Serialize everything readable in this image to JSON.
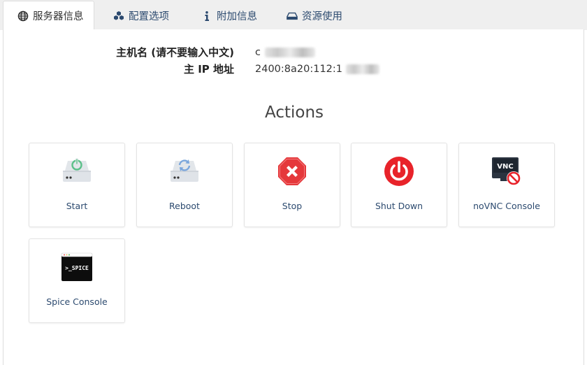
{
  "tabs": [
    {
      "label": "服务器信息",
      "icon": "globe-icon",
      "active": true
    },
    {
      "label": "配置选项",
      "icon": "cubes-icon",
      "active": false
    },
    {
      "label": "附加信息",
      "icon": "info-icon",
      "active": false
    },
    {
      "label": "资源使用",
      "icon": "hdd-icon",
      "active": false
    }
  ],
  "server_info": {
    "hostname_label": "主机名 (请不要输入中文)",
    "hostname_value": "c",
    "ip_label": "主 IP 地址",
    "ip_value": "2400:8a20:112:1"
  },
  "actions": {
    "title": "Actions",
    "items": [
      {
        "label": "Start",
        "icon": "power-drive-icon"
      },
      {
        "label": "Reboot",
        "icon": "reboot-drive-icon"
      },
      {
        "label": "Stop",
        "icon": "stop-octagon-icon"
      },
      {
        "label": "Shut Down",
        "icon": "shutdown-power-icon"
      },
      {
        "label": "noVNC Console",
        "icon": "vnc-monitor-icon"
      },
      {
        "label": "Spice Console",
        "icon": "spice-terminal-icon"
      }
    ]
  },
  "colors": {
    "tab_text": "#2c4a6f",
    "start_green": "#5cc08a",
    "reboot_blue": "#7aa6dc",
    "stop_red": "#e5383b",
    "shutdown_red": "#e8232a"
  }
}
